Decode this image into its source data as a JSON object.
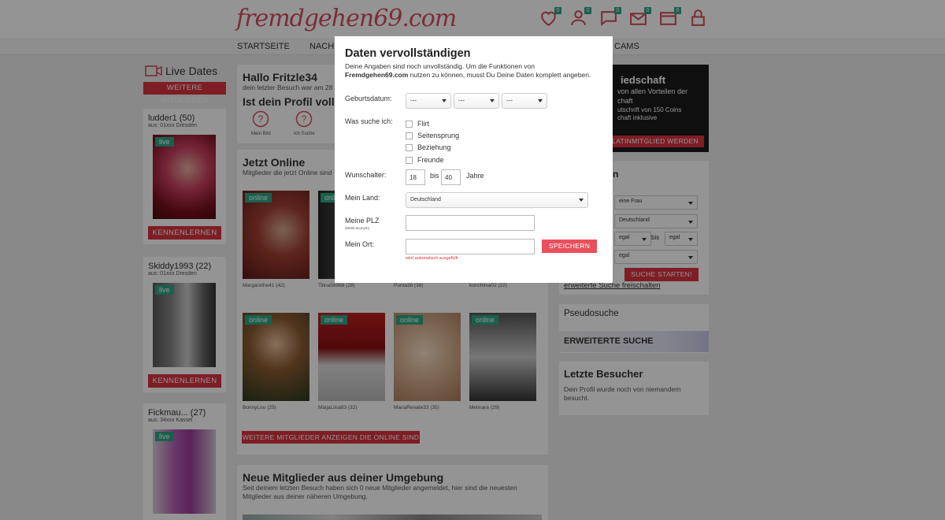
{
  "header": {
    "logo": "fremdgehen69.com",
    "badges": [
      "0",
      "0",
      "0",
      "0",
      "0"
    ]
  },
  "nav": {
    "items": [
      "STARTSEITE",
      "NACH",
      "CAMS"
    ]
  },
  "left": {
    "title": "Live Dates",
    "more_button": "WEITERE MITGLIEDER",
    "cards": [
      {
        "name": "ludder1 (50)",
        "location": "aus: 01xxx Dresden",
        "tag": "live",
        "button": "KENNENLERNEN"
      },
      {
        "name": "Skiddy1993 (22)",
        "location": "aus: 01xxx Dresden",
        "tag": "live",
        "button": "KENNENLERNEN"
      },
      {
        "name": "Fickmau... (27)",
        "location": "aus: 34xxx Kassel",
        "tag": "live"
      }
    ]
  },
  "main": {
    "hello_title": "Hallo Fritzle34",
    "hello_sub": "dein letzter Besuch war am 28",
    "profile_title": "Ist dein Profil vollst",
    "profile_icons": [
      "Mein Bild",
      "Ich Suche"
    ],
    "online_title": "Jetzt Online",
    "online_sub": "Mitglieder die jetzt Online sind",
    "online_tag": "online",
    "online_row1": [
      "Margarethe41 (42)",
      "Tilina56988 (28)",
      "Punta36 (38)",
      "konchitsa02 (22)"
    ],
    "online_row2": [
      "BonnyLou (25)",
      "MaijaLiisa83 (32)",
      "MariaRenate33 (35)",
      "Melinara (29)"
    ],
    "more_online_button": "WEITERE MITGLIEDER ANZEIGEN DIE ONLINE SIND",
    "new_title": "Neue Mitglieder aus deiner Umgebung",
    "new_sub": "Seit deinem letzten Besuch haben sich 0 neue Mitglieder angemeldet, hier sind die neuesten Mitglieder aus deiner näheren Umgebung."
  },
  "right": {
    "promo_title": "iedschaft",
    "promo_l1": "von allen Vorteilen der",
    "promo_l2": "chaft",
    "promo_l3": "utschrift von 150 Coins",
    "promo_l4": "chaft inklusive",
    "promo_button": "LATINMITGLIED WERDEN",
    "search_heading": "n",
    "search_sel1": "eine Frau",
    "search_sel2": "Deutschland",
    "search_from": "egal",
    "search_bis": "bis",
    "search_to": "egal",
    "search_sel4": "egal",
    "search_button": "SUCHE STARTEN!",
    "extended_link": "erweiterte Suche freischalten",
    "pseudo_title": "Pseudosuche",
    "extended_title": "ERWEITERTE SUCHE",
    "visitors_title": "Letzte Besucher",
    "visitors_text": "Dein Profil wurde noch von niemandem besucht."
  },
  "modal": {
    "title": "Daten vervollständigen",
    "intro_a": "Deine Angaben sind noch unvollständig. Um die Funktionen von",
    "intro_brand": "Fremdgehen69.com",
    "intro_b": " nutzen zu können, musst Du Deine Daten komplett angeben.",
    "birth_label": "Geburtsdatum:",
    "birth_values": [
      "---",
      "---",
      "---"
    ],
    "search_label": "Was suche ich:",
    "options": [
      "Flirt",
      "Seitensprung",
      "Beziehung",
      "Freunde"
    ],
    "age_label": "Wunschalter:",
    "age_from": "18",
    "age_bis": "bis",
    "age_to": "40",
    "age_unit": "Jahre",
    "country_label": "Mein Land:",
    "country_value": "Deutschland",
    "plz_label": "Meine PLZ",
    "plz_hint": "(bleibt anonym)",
    "city_label": "Mein Ort:",
    "city_hint": "wird automatisch ausgefüllt",
    "save_button": "SPEICHERN"
  }
}
